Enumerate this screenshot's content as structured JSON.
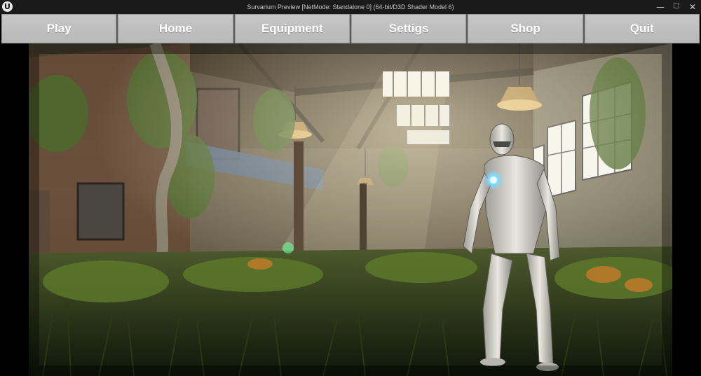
{
  "window": {
    "title": "Survarium Preview [NetMode: Standalone 0]  (64-bit/D3D Shader Model 6)",
    "logo_glyph": "U",
    "minimize_glyph": "—",
    "maximize_glyph": "☐",
    "close_glyph": "✕"
  },
  "menu": {
    "items": [
      {
        "label": "Play"
      },
      {
        "label": "Home"
      },
      {
        "label": "Equipment"
      },
      {
        "label": "Settigs"
      },
      {
        "label": "Shop"
      },
      {
        "label": "Quit"
      }
    ]
  },
  "scene": {
    "description_icons": [
      "engine-logo-icon",
      "robot-character",
      "ceiling-lamp",
      "skylight-window"
    ],
    "colors": {
      "menu_button": "#bfbfbf",
      "title_bar": "#1a1a1a",
      "chest_glow": "#7fd8ff"
    }
  }
}
